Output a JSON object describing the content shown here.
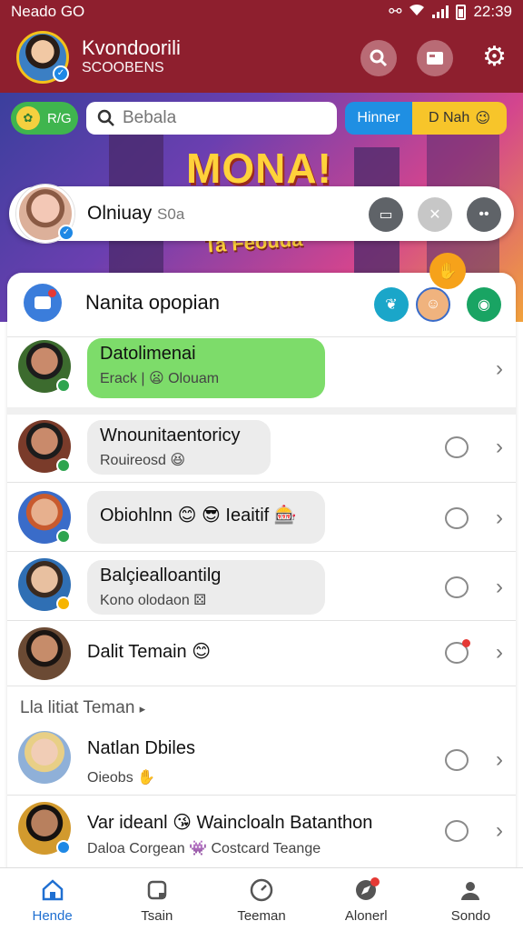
{
  "status_bar": {
    "left_text": "Neado GO",
    "time": "22:39"
  },
  "header": {
    "name": "Kvondoorili",
    "subtitle": "SCOOBENS"
  },
  "toolbar": {
    "green_chip": "R/G",
    "search_placeholder": "Bebala",
    "blue_chip": "Hinner",
    "yellow_chip": "D Nah"
  },
  "banner": {
    "title": "MONA!",
    "subtitle": "Ta Feouda"
  },
  "story": {
    "name": "Olniuay",
    "suffix": "S0a"
  },
  "section": {
    "title": "Nanita opopian"
  },
  "rows": [
    {
      "line1": "Datolimenai",
      "line2": "Erack | 😦 Olouam"
    },
    {
      "line1": "Wnounitaentoricy",
      "line2": "Rouireosd 😆"
    },
    {
      "line1": "Obiohlnn 😊 😎 Ieaitif 🎰",
      "line2": ""
    },
    {
      "line1": "Balçiealloantilg",
      "line2": "Kono olodaon"
    },
    {
      "line1": "Dalit Temain 😊",
      "line2": ""
    }
  ],
  "friends_label": "Lla litiat Teman",
  "friends": [
    {
      "line1": "Natlan Dbiles",
      "line2": "Oieobs"
    },
    {
      "line1": "Var ideanl 😘 Waincloaln Batanthon",
      "line2": "Daloa Corgean 👾 Costcard Teange"
    }
  ],
  "nav": [
    {
      "label": "Hende",
      "icon": "home-icon",
      "active": true
    },
    {
      "label": "Tsain",
      "icon": "square-icon",
      "active": false
    },
    {
      "label": "Teeman",
      "icon": "clock-icon",
      "active": false
    },
    {
      "label": "Alonerl",
      "icon": "compass-icon",
      "active": false
    },
    {
      "label": "Sondo",
      "icon": "person-icon",
      "active": false
    }
  ],
  "colors": {
    "header": "#8e1f2e",
    "accent_blue": "#1f6fd1",
    "green_bubble": "#7ddc6a"
  }
}
